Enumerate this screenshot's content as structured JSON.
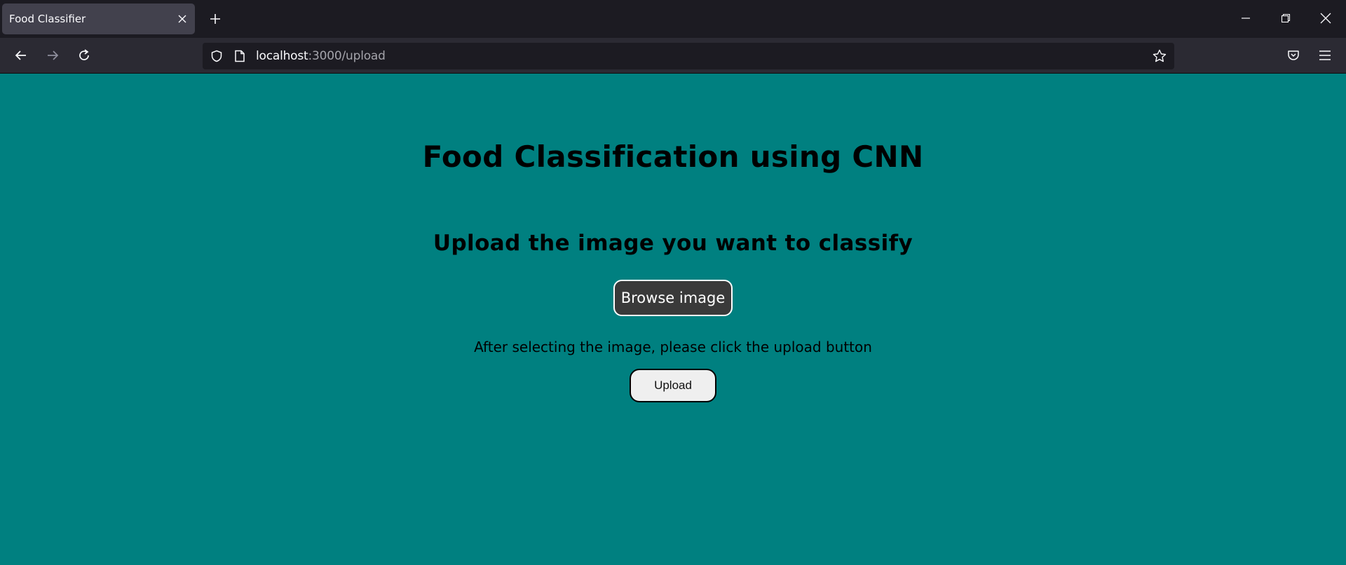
{
  "browser": {
    "tab": {
      "title": "Food Classifier"
    },
    "address_bar": {
      "host": "localhost",
      "path": ":3000/upload"
    }
  },
  "page": {
    "title": "Food Classification using CNN",
    "subtitle": "Upload the image you want to classify",
    "browse_button": "Browse image",
    "instruction": "After selecting the image, please click the upload button",
    "upload_button": "Upload"
  },
  "colors": {
    "page_background": "#008080",
    "browse_button_bg": "#3a3a3a",
    "upload_button_bg": "#efefef",
    "tabbar_bg": "#1c1b22",
    "navbar_bg": "#2b2a33"
  },
  "icons": {
    "tab_close": "close-icon",
    "new_tab": "plus-icon",
    "minimize": "minimize-icon",
    "restore": "restore-icon",
    "close_window": "close-window-icon",
    "back": "back-arrow-icon",
    "forward": "forward-arrow-icon",
    "reload": "reload-icon",
    "tracking_protection": "shield-icon",
    "page_info": "page-icon",
    "bookmark": "star-icon",
    "pocket": "pocket-icon",
    "menu": "hamburger-menu-icon"
  }
}
